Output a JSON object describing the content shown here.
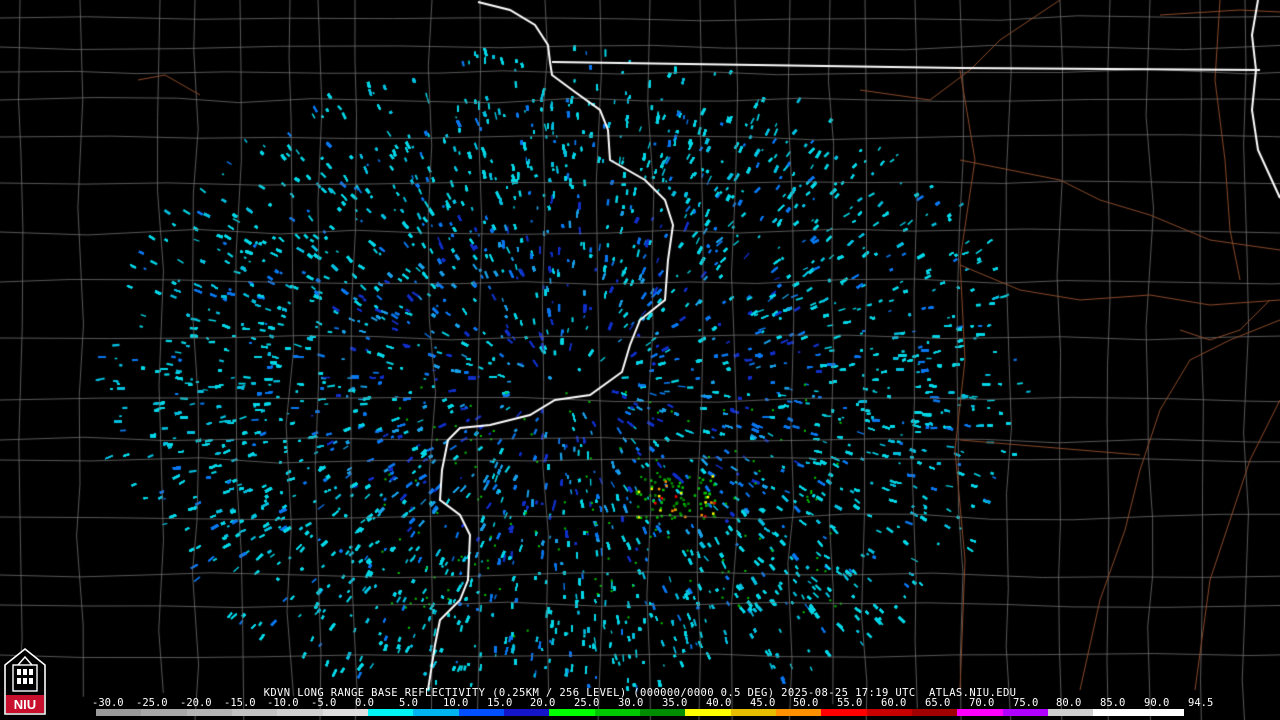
{
  "map": {
    "caption": "KDVN LONG RANGE BASE REFLECTIVITY (0.25KM / 256 LEVEL) (000000/0000 0.5 DEG) 2025-08-25 17:19 UTC  ATLAS.NIU.EDU"
  },
  "scale": {
    "labels": [
      "-30.0",
      "-25.0",
      "-20.0",
      "-15.0",
      "-10.0",
      "-5.0",
      "0.0",
      "5.0",
      "10.0",
      "15.0",
      "20.0",
      "25.0",
      "30.0",
      "35.0",
      "40.0",
      "45.0",
      "50.0",
      "55.0",
      "60.0",
      "65.0",
      "70.0",
      "75.0",
      "80.0",
      "85.0",
      "90.0",
      "94.5"
    ],
    "colors": [
      "#9a9a9a",
      "#a8a8a8",
      "#b5b5b5",
      "#c3c3c3",
      "#d0d0d0",
      "#dedede",
      "#00f5f5",
      "#00b4f0",
      "#0050ff",
      "#1414c8",
      "#00ff00",
      "#00c800",
      "#008c00",
      "#ffff00",
      "#e6be00",
      "#ff9000",
      "#ff0000",
      "#c80000",
      "#a00000",
      "#ff00ff",
      "#b000ff",
      "#cfcfcf",
      "#ffffff",
      "#ffffff"
    ]
  },
  "logo": {
    "text": "NIU"
  }
}
